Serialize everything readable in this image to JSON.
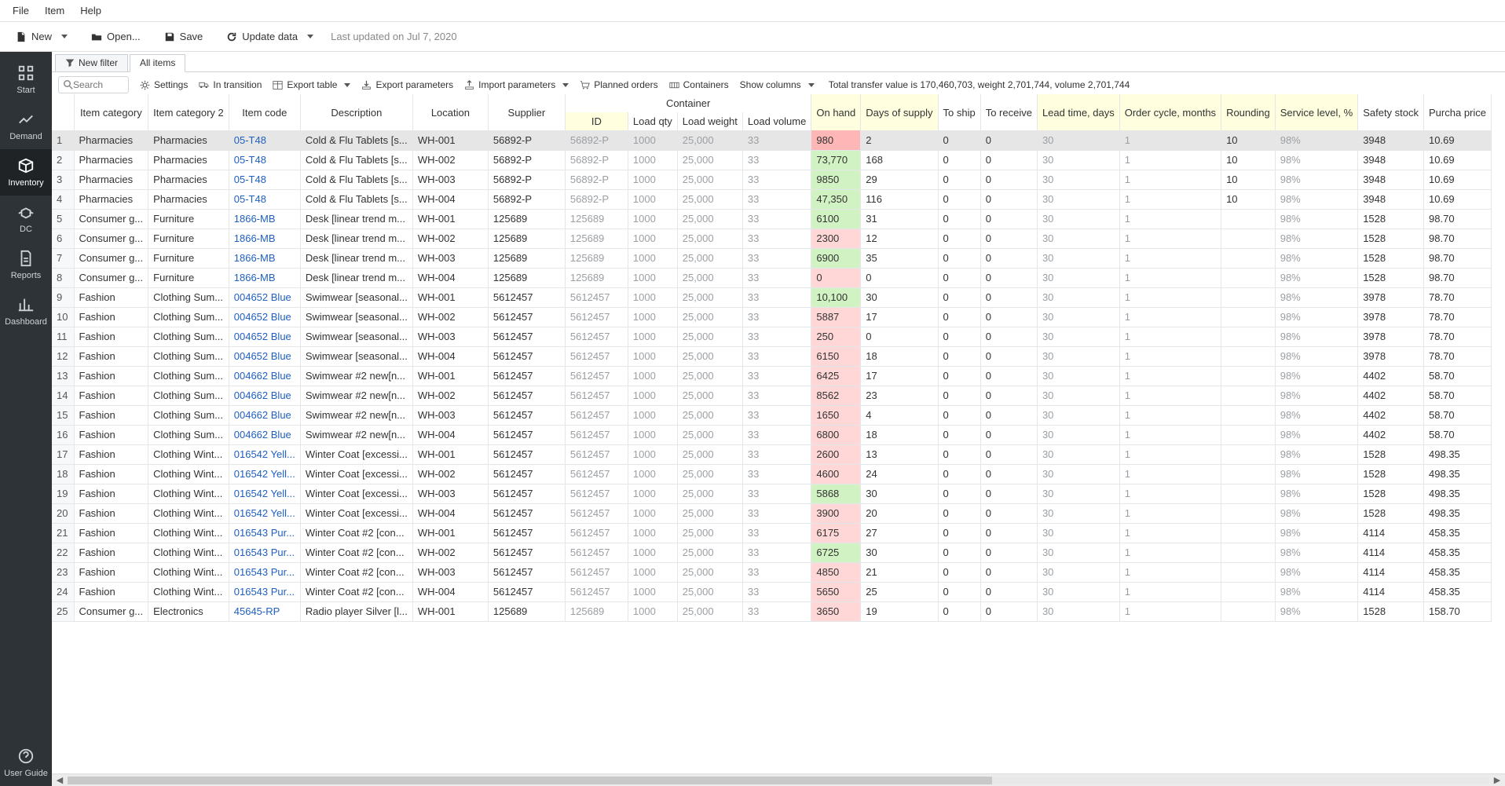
{
  "menu": [
    "File",
    "Item",
    "Help"
  ],
  "toolbar": {
    "new": "New",
    "open": "Open...",
    "save": "Save",
    "update": "Update data",
    "status": "Last updated on Jul 7, 2020"
  },
  "sidebar": {
    "items": [
      "Start",
      "Demand",
      "Inventory",
      "DC",
      "Reports",
      "Dashboard"
    ],
    "activeIndex": 2,
    "footer": "User Guide"
  },
  "tabs": [
    {
      "label": "New filter",
      "active": false
    },
    {
      "label": "All items",
      "active": true
    }
  ],
  "toolbar2": {
    "search_placeholder": "Search",
    "settings": "Settings",
    "in_transition": "In transition",
    "export_table": "Export table",
    "export_params": "Export parameters",
    "import_params": "Import parameters",
    "planned_orders": "Planned orders",
    "containers": "Containers",
    "show_columns": "Show columns",
    "totals": "Total transfer value is 170,460,703, weight 2,701,744, volume 2,701,744"
  },
  "columns": {
    "rownum": "",
    "item_cat": "Item category",
    "item_cat2": "Item category 2",
    "item_code": "Item code",
    "description": "Description",
    "location": "Location",
    "supplier": "Supplier",
    "container": "Container",
    "container_id": "ID",
    "container_load_qty": "Load qty",
    "container_load_weight": "Load weight",
    "container_load_volume": "Load volume",
    "on_hand": "On hand",
    "days_supply": "Days of supply",
    "to_ship": "To ship",
    "to_receive": "To receive",
    "lead_time": "Lead time, days",
    "order_cycle": "Order cycle, months",
    "rounding": "Rounding",
    "service_level": "Service level, %",
    "safety_stock": "Safety stock",
    "purchase_price": "Purcha price"
  },
  "colWidths": {
    "rownum": 28,
    "item_cat": 82,
    "item_cat2": 94,
    "item_code": 70,
    "description": 124,
    "location": 96,
    "supplier": 98,
    "container_id": 80,
    "container_load_qty": 48,
    "container_load_weight": 72,
    "container_load_volume": 74,
    "on_hand": 50,
    "days_supply": 56,
    "to_ship": 44,
    "to_receive": 60,
    "lead_time": 60,
    "order_cycle": 64,
    "rounding": 58,
    "service_level": 50,
    "safety_stock": 46,
    "purchase_price": 50
  },
  "rows": [
    {
      "n": 1,
      "cat": "Pharmacies",
      "cat2": "Pharmacies",
      "code": "05-T48",
      "desc": "Cold & Flu Tablets [s...",
      "loc": "WH-001",
      "supp": "56892-P",
      "cid": "56892-P",
      "lq": "1000",
      "lw": "25,000",
      "lv": "33",
      "oh": "980",
      "ohc": "r",
      "dos": "2",
      "ship": "0",
      "recv": "0",
      "lt": "30",
      "oc": "1",
      "rnd": "10",
      "sl": "98%",
      "ss": "3948",
      "pp": "10.69",
      "sel": true
    },
    {
      "n": 2,
      "cat": "Pharmacies",
      "cat2": "Pharmacies",
      "code": "05-T48",
      "desc": "Cold & Flu Tablets [s...",
      "loc": "WH-002",
      "supp": "56892-P",
      "cid": "56892-P",
      "lq": "1000",
      "lw": "25,000",
      "lv": "33",
      "oh": "73,770",
      "ohc": "g",
      "dos": "168",
      "ship": "0",
      "recv": "0",
      "lt": "30",
      "oc": "1",
      "rnd": "10",
      "sl": "98%",
      "ss": "3948",
      "pp": "10.69"
    },
    {
      "n": 3,
      "cat": "Pharmacies",
      "cat2": "Pharmacies",
      "code": "05-T48",
      "desc": "Cold & Flu Tablets [s...",
      "loc": "WH-003",
      "supp": "56892-P",
      "cid": "56892-P",
      "lq": "1000",
      "lw": "25,000",
      "lv": "33",
      "oh": "9850",
      "ohc": "g",
      "dos": "29",
      "ship": "0",
      "recv": "0",
      "lt": "30",
      "oc": "1",
      "rnd": "10",
      "sl": "98%",
      "ss": "3948",
      "pp": "10.69"
    },
    {
      "n": 4,
      "cat": "Pharmacies",
      "cat2": "Pharmacies",
      "code": "05-T48",
      "desc": "Cold & Flu Tablets [s...",
      "loc": "WH-004",
      "supp": "56892-P",
      "cid": "56892-P",
      "lq": "1000",
      "lw": "25,000",
      "lv": "33",
      "oh": "47,350",
      "ohc": "g",
      "dos": "116",
      "ship": "0",
      "recv": "0",
      "lt": "30",
      "oc": "1",
      "rnd": "10",
      "sl": "98%",
      "ss": "3948",
      "pp": "10.69"
    },
    {
      "n": 5,
      "cat": "Consumer g...",
      "cat2": "Furniture",
      "code": "1866-MB",
      "desc": "Desk [linear trend m...",
      "loc": "WH-001",
      "supp": "125689",
      "cid": "125689",
      "lq": "1000",
      "lw": "25,000",
      "lv": "33",
      "oh": "6100",
      "ohc": "g",
      "dos": "31",
      "ship": "0",
      "recv": "0",
      "lt": "30",
      "oc": "1",
      "rnd": "",
      "sl": "98%",
      "ss": "1528",
      "pp": "98.70"
    },
    {
      "n": 6,
      "cat": "Consumer g...",
      "cat2": "Furniture",
      "code": "1866-MB",
      "desc": "Desk [linear trend m...",
      "loc": "WH-002",
      "supp": "125689",
      "cid": "125689",
      "lq": "1000",
      "lw": "25,000",
      "lv": "33",
      "oh": "2300",
      "ohc": "r",
      "dos": "12",
      "ship": "0",
      "recv": "0",
      "lt": "30",
      "oc": "1",
      "rnd": "",
      "sl": "98%",
      "ss": "1528",
      "pp": "98.70"
    },
    {
      "n": 7,
      "cat": "Consumer g...",
      "cat2": "Furniture",
      "code": "1866-MB",
      "desc": "Desk [linear trend m...",
      "loc": "WH-003",
      "supp": "125689",
      "cid": "125689",
      "lq": "1000",
      "lw": "25,000",
      "lv": "33",
      "oh": "6900",
      "ohc": "g",
      "dos": "35",
      "ship": "0",
      "recv": "0",
      "lt": "30",
      "oc": "1",
      "rnd": "",
      "sl": "98%",
      "ss": "1528",
      "pp": "98.70"
    },
    {
      "n": 8,
      "cat": "Consumer g...",
      "cat2": "Furniture",
      "code": "1866-MB",
      "desc": "Desk [linear trend m...",
      "loc": "WH-004",
      "supp": "125689",
      "cid": "125689",
      "lq": "1000",
      "lw": "25,000",
      "lv": "33",
      "oh": "0",
      "ohc": "r",
      "dos": "0",
      "ship": "0",
      "recv": "0",
      "lt": "30",
      "oc": "1",
      "rnd": "",
      "sl": "98%",
      "ss": "1528",
      "pp": "98.70"
    },
    {
      "n": 9,
      "cat": "Fashion",
      "cat2": "Clothing Sum...",
      "code": "004652 Blue",
      "desc": "Swimwear [seasonal...",
      "loc": "WH-001",
      "supp": "5612457",
      "cid": "5612457",
      "lq": "1000",
      "lw": "25,000",
      "lv": "33",
      "oh": "10,100",
      "ohc": "g",
      "dos": "30",
      "ship": "0",
      "recv": "0",
      "lt": "30",
      "oc": "1",
      "rnd": "",
      "sl": "98%",
      "ss": "3978",
      "pp": "78.70"
    },
    {
      "n": 10,
      "cat": "Fashion",
      "cat2": "Clothing Sum...",
      "code": "004652 Blue",
      "desc": "Swimwear [seasonal...",
      "loc": "WH-002",
      "supp": "5612457",
      "cid": "5612457",
      "lq": "1000",
      "lw": "25,000",
      "lv": "33",
      "oh": "5887",
      "ohc": "r",
      "dos": "17",
      "ship": "0",
      "recv": "0",
      "lt": "30",
      "oc": "1",
      "rnd": "",
      "sl": "98%",
      "ss": "3978",
      "pp": "78.70"
    },
    {
      "n": 11,
      "cat": "Fashion",
      "cat2": "Clothing Sum...",
      "code": "004652 Blue",
      "desc": "Swimwear [seasonal...",
      "loc": "WH-003",
      "supp": "5612457",
      "cid": "5612457",
      "lq": "1000",
      "lw": "25,000",
      "lv": "33",
      "oh": "250",
      "ohc": "r",
      "dos": "0",
      "ship": "0",
      "recv": "0",
      "lt": "30",
      "oc": "1",
      "rnd": "",
      "sl": "98%",
      "ss": "3978",
      "pp": "78.70"
    },
    {
      "n": 12,
      "cat": "Fashion",
      "cat2": "Clothing Sum...",
      "code": "004652 Blue",
      "desc": "Swimwear [seasonal...",
      "loc": "WH-004",
      "supp": "5612457",
      "cid": "5612457",
      "lq": "1000",
      "lw": "25,000",
      "lv": "33",
      "oh": "6150",
      "ohc": "r",
      "dos": "18",
      "ship": "0",
      "recv": "0",
      "lt": "30",
      "oc": "1",
      "rnd": "",
      "sl": "98%",
      "ss": "3978",
      "pp": "78.70"
    },
    {
      "n": 13,
      "cat": "Fashion",
      "cat2": "Clothing Sum...",
      "code": "004662 Blue",
      "desc": "Swimwear #2 new[n...",
      "loc": "WH-001",
      "supp": "5612457",
      "cid": "5612457",
      "lq": "1000",
      "lw": "25,000",
      "lv": "33",
      "oh": "6425",
      "ohc": "r",
      "dos": "17",
      "ship": "0",
      "recv": "0",
      "lt": "30",
      "oc": "1",
      "rnd": "",
      "sl": "98%",
      "ss": "4402",
      "pp": "58.70"
    },
    {
      "n": 14,
      "cat": "Fashion",
      "cat2": "Clothing Sum...",
      "code": "004662 Blue",
      "desc": "Swimwear #2 new[n...",
      "loc": "WH-002",
      "supp": "5612457",
      "cid": "5612457",
      "lq": "1000",
      "lw": "25,000",
      "lv": "33",
      "oh": "8562",
      "ohc": "r",
      "dos": "23",
      "ship": "0",
      "recv": "0",
      "lt": "30",
      "oc": "1",
      "rnd": "",
      "sl": "98%",
      "ss": "4402",
      "pp": "58.70"
    },
    {
      "n": 15,
      "cat": "Fashion",
      "cat2": "Clothing Sum...",
      "code": "004662 Blue",
      "desc": "Swimwear #2 new[n...",
      "loc": "WH-003",
      "supp": "5612457",
      "cid": "5612457",
      "lq": "1000",
      "lw": "25,000",
      "lv": "33",
      "oh": "1650",
      "ohc": "r",
      "dos": "4",
      "ship": "0",
      "recv": "0",
      "lt": "30",
      "oc": "1",
      "rnd": "",
      "sl": "98%",
      "ss": "4402",
      "pp": "58.70"
    },
    {
      "n": 16,
      "cat": "Fashion",
      "cat2": "Clothing Sum...",
      "code": "004662 Blue",
      "desc": "Swimwear #2 new[n...",
      "loc": "WH-004",
      "supp": "5612457",
      "cid": "5612457",
      "lq": "1000",
      "lw": "25,000",
      "lv": "33",
      "oh": "6800",
      "ohc": "r",
      "dos": "18",
      "ship": "0",
      "recv": "0",
      "lt": "30",
      "oc": "1",
      "rnd": "",
      "sl": "98%",
      "ss": "4402",
      "pp": "58.70"
    },
    {
      "n": 17,
      "cat": "Fashion",
      "cat2": "Clothing Wint...",
      "code": "016542 Yell...",
      "desc": "Winter Coat [excessi...",
      "loc": "WH-001",
      "supp": "5612457",
      "cid": "5612457",
      "lq": "1000",
      "lw": "25,000",
      "lv": "33",
      "oh": "2600",
      "ohc": "r",
      "dos": "13",
      "ship": "0",
      "recv": "0",
      "lt": "30",
      "oc": "1",
      "rnd": "",
      "sl": "98%",
      "ss": "1528",
      "pp": "498.35"
    },
    {
      "n": 18,
      "cat": "Fashion",
      "cat2": "Clothing Wint...",
      "code": "016542 Yell...",
      "desc": "Winter Coat [excessi...",
      "loc": "WH-002",
      "supp": "5612457",
      "cid": "5612457",
      "lq": "1000",
      "lw": "25,000",
      "lv": "33",
      "oh": "4600",
      "ohc": "r",
      "dos": "24",
      "ship": "0",
      "recv": "0",
      "lt": "30",
      "oc": "1",
      "rnd": "",
      "sl": "98%",
      "ss": "1528",
      "pp": "498.35"
    },
    {
      "n": 19,
      "cat": "Fashion",
      "cat2": "Clothing Wint...",
      "code": "016542 Yell...",
      "desc": "Winter Coat [excessi...",
      "loc": "WH-003",
      "supp": "5612457",
      "cid": "5612457",
      "lq": "1000",
      "lw": "25,000",
      "lv": "33",
      "oh": "5868",
      "ohc": "g",
      "dos": "30",
      "ship": "0",
      "recv": "0",
      "lt": "30",
      "oc": "1",
      "rnd": "",
      "sl": "98%",
      "ss": "1528",
      "pp": "498.35"
    },
    {
      "n": 20,
      "cat": "Fashion",
      "cat2": "Clothing Wint...",
      "code": "016542 Yell...",
      "desc": "Winter Coat [excessi...",
      "loc": "WH-004",
      "supp": "5612457",
      "cid": "5612457",
      "lq": "1000",
      "lw": "25,000",
      "lv": "33",
      "oh": "3900",
      "ohc": "r",
      "dos": "20",
      "ship": "0",
      "recv": "0",
      "lt": "30",
      "oc": "1",
      "rnd": "",
      "sl": "98%",
      "ss": "1528",
      "pp": "498.35"
    },
    {
      "n": 21,
      "cat": "Fashion",
      "cat2": "Clothing Wint...",
      "code": "016543 Pur...",
      "desc": "Winter Coat #2 [con...",
      "loc": "WH-001",
      "supp": "5612457",
      "cid": "5612457",
      "lq": "1000",
      "lw": "25,000",
      "lv": "33",
      "oh": "6175",
      "ohc": "r",
      "dos": "27",
      "ship": "0",
      "recv": "0",
      "lt": "30",
      "oc": "1",
      "rnd": "",
      "sl": "98%",
      "ss": "4114",
      "pp": "458.35"
    },
    {
      "n": 22,
      "cat": "Fashion",
      "cat2": "Clothing Wint...",
      "code": "016543 Pur...",
      "desc": "Winter Coat #2 [con...",
      "loc": "WH-002",
      "supp": "5612457",
      "cid": "5612457",
      "lq": "1000",
      "lw": "25,000",
      "lv": "33",
      "oh": "6725",
      "ohc": "g",
      "dos": "30",
      "ship": "0",
      "recv": "0",
      "lt": "30",
      "oc": "1",
      "rnd": "",
      "sl": "98%",
      "ss": "4114",
      "pp": "458.35"
    },
    {
      "n": 23,
      "cat": "Fashion",
      "cat2": "Clothing Wint...",
      "code": "016543 Pur...",
      "desc": "Winter Coat #2 [con...",
      "loc": "WH-003",
      "supp": "5612457",
      "cid": "5612457",
      "lq": "1000",
      "lw": "25,000",
      "lv": "33",
      "oh": "4850",
      "ohc": "r",
      "dos": "21",
      "ship": "0",
      "recv": "0",
      "lt": "30",
      "oc": "1",
      "rnd": "",
      "sl": "98%",
      "ss": "4114",
      "pp": "458.35"
    },
    {
      "n": 24,
      "cat": "Fashion",
      "cat2": "Clothing Wint...",
      "code": "016543 Pur...",
      "desc": "Winter Coat #2 [con...",
      "loc": "WH-004",
      "supp": "5612457",
      "cid": "5612457",
      "lq": "1000",
      "lw": "25,000",
      "lv": "33",
      "oh": "5650",
      "ohc": "r",
      "dos": "25",
      "ship": "0",
      "recv": "0",
      "lt": "30",
      "oc": "1",
      "rnd": "",
      "sl": "98%",
      "ss": "4114",
      "pp": "458.35"
    },
    {
      "n": 25,
      "cat": "Consumer g...",
      "cat2": "Electronics",
      "code": "45645-RP",
      "desc": "Radio player Silver [l...",
      "loc": "WH-001",
      "supp": "125689",
      "cid": "125689",
      "lq": "1000",
      "lw": "25,000",
      "lv": "33",
      "oh": "3650",
      "ohc": "r",
      "dos": "19",
      "ship": "0",
      "recv": "0",
      "lt": "30",
      "oc": "1",
      "rnd": "",
      "sl": "98%",
      "ss": "1528",
      "pp": "158.70"
    }
  ]
}
